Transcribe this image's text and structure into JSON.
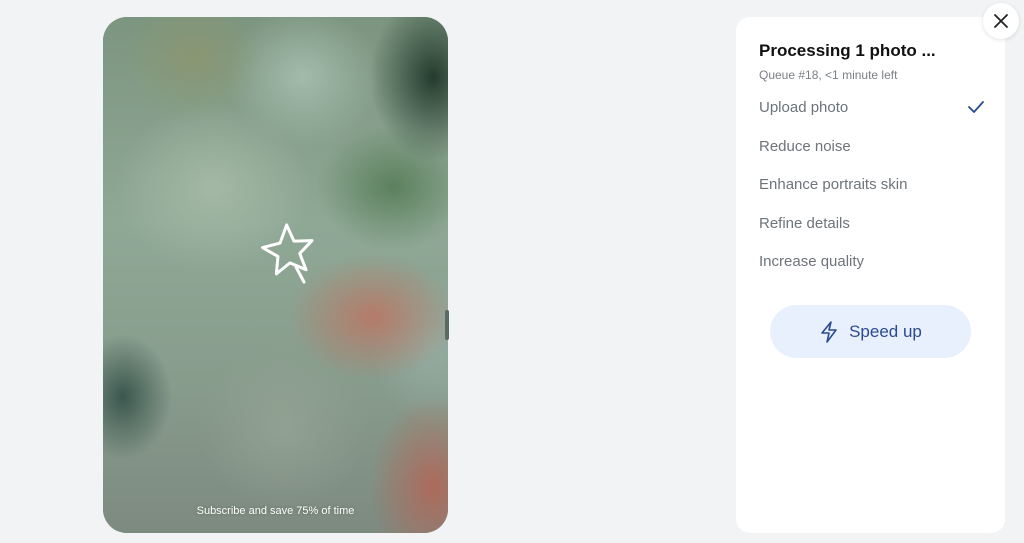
{
  "photo": {
    "subscribe_text": "Subscribe and save 75% of time",
    "overlay_icon": "magic-star-icon"
  },
  "panel": {
    "title": "Processing 1 photo ...",
    "subtitle": "Queue #18, <1 minute left",
    "steps": [
      {
        "label": "Upload photo",
        "done": true
      },
      {
        "label": "Reduce noise",
        "done": false
      },
      {
        "label": "Enhance portraits skin",
        "done": false
      },
      {
        "label": "Refine details",
        "done": false
      },
      {
        "label": "Increase quality",
        "done": false
      }
    ],
    "speed_up_label": "Speed up",
    "speed_up_icon": "lightning-icon"
  },
  "close_icon": "close-icon",
  "colors": {
    "accent": "#2b4b8f",
    "button_bg": "#e9f0fd",
    "page_bg": "#f1f3f5"
  }
}
